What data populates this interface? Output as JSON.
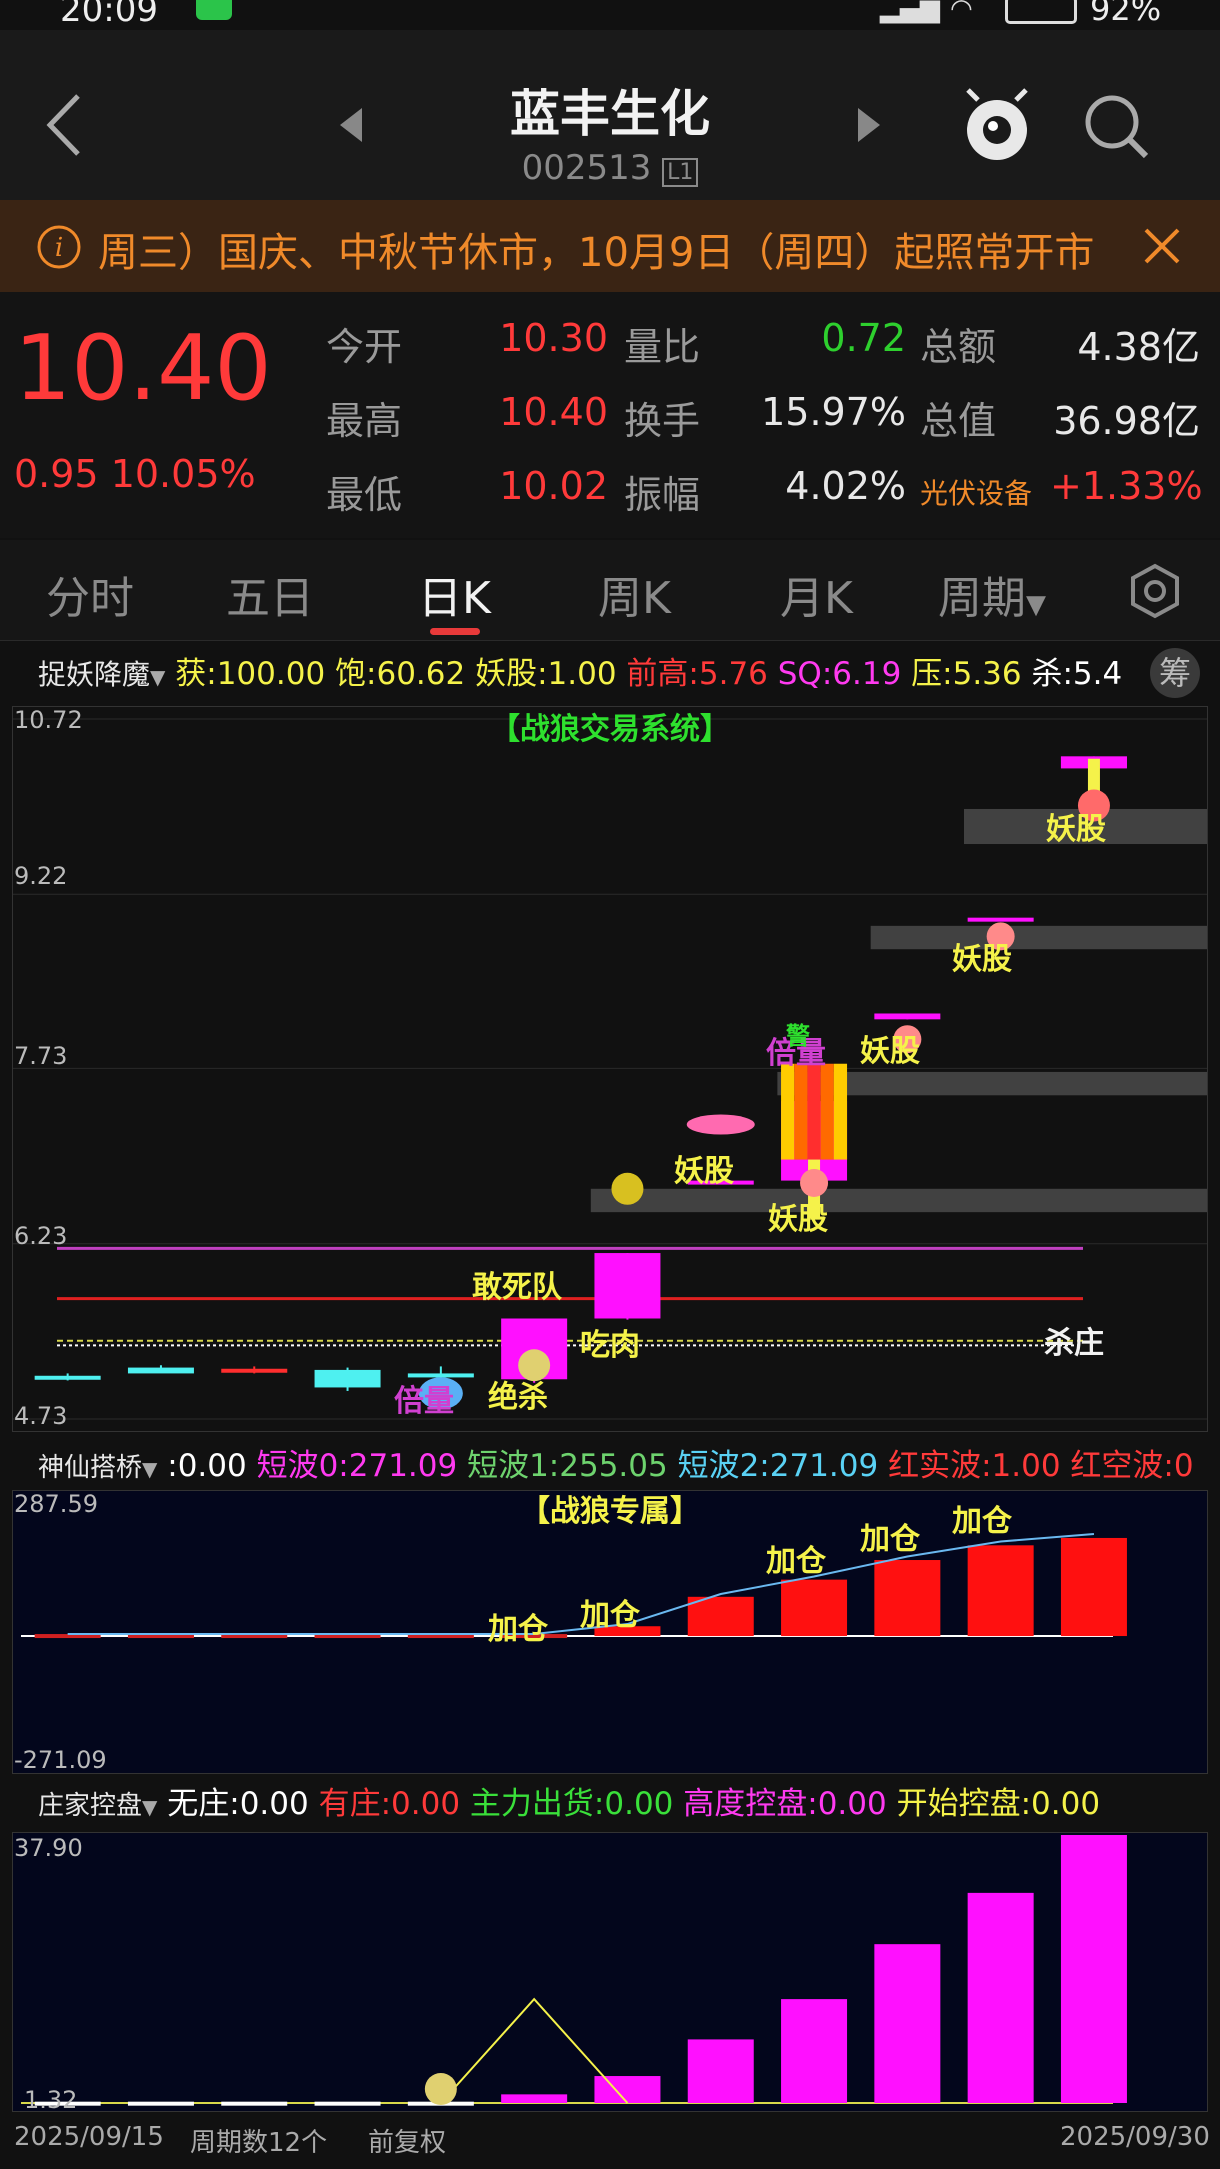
{
  "status": {
    "time": "20:09",
    "battery": "92%"
  },
  "header": {
    "title": "蓝丰生化",
    "code": "002513",
    "level_badge": "L1"
  },
  "notice": {
    "text": "周三）国庆、中秋节休市，10月9日（周四）起照常开市"
  },
  "quote": {
    "price": "10.40",
    "change": "0.95",
    "change_pct": "10.05%",
    "fields": {
      "open_label": "今开",
      "open": "10.30",
      "vol_ratio_label": "量比",
      "vol_ratio": "0.72",
      "amount_label": "总额",
      "amount": "4.38亿",
      "high_label": "最高",
      "high": "10.40",
      "turnover_label": "换手",
      "turnover": "15.97%",
      "mktcap_label": "总值",
      "mktcap": "36.98亿",
      "low_label": "最低",
      "low": "10.02",
      "amplitude_label": "振幅",
      "amplitude": "4.02%",
      "sector_label": "光伏设备",
      "sector_change": "+1.33%"
    }
  },
  "tabs": [
    {
      "label": "分时"
    },
    {
      "label": "五日"
    },
    {
      "label": "日K"
    },
    {
      "label": "周K"
    },
    {
      "label": "月K"
    },
    {
      "label": "周期"
    }
  ],
  "indicator1": {
    "name": "捉妖降魔",
    "items": [
      {
        "text": "获:100.00",
        "color": "#f5f24a"
      },
      {
        "text": "饱:60.62",
        "color": "#f5f24a"
      },
      {
        "text": "妖股:1.00",
        "color": "#f5f24a"
      },
      {
        "text": "前高:5.76",
        "color": "#ff3a3a"
      },
      {
        "text": "SQ:6.19",
        "color": "#ff3af0"
      },
      {
        "text": "压:5.36",
        "color": "#f5f24a"
      },
      {
        "text": "杀:5.4",
        "color": "#ffffff"
      }
    ],
    "chip_button": "筹"
  },
  "indicator2": {
    "name": "神仙搭桥",
    "items": [
      {
        "text": ":0.00",
        "color": "#ffffff"
      },
      {
        "text": "短波0:271.09",
        "color": "#ff3af0"
      },
      {
        "text": "短波1:255.05",
        "color": "#6ed36e"
      },
      {
        "text": "短波2:271.09",
        "color": "#5ad2f5"
      },
      {
        "text": "红实波:1.00",
        "color": "#ff3a3a"
      },
      {
        "text": "红空波:0",
        "color": "#ff3a3a"
      }
    ]
  },
  "indicator3": {
    "name": "庄家控盘",
    "items": [
      {
        "text": "无庄:0.00",
        "color": "#ffffff"
      },
      {
        "text": "有庄:0.00",
        "color": "#ff3a3a"
      },
      {
        "text": "主力出货:0.00",
        "color": "#3ae03a"
      },
      {
        "text": "高度控盘:0.00",
        "color": "#ff3af0"
      },
      {
        "text": "开始控盘:0.00",
        "color": "#f5f24a"
      }
    ]
  },
  "main_chart": {
    "title": "【战狼交易系统】",
    "y_ticks": [
      "10.72",
      "9.22",
      "7.73",
      "6.23",
      "4.73"
    ],
    "labels": {
      "gansidui": "敢死队",
      "chirou": "吃肉",
      "juesha": "绝杀",
      "beiliang1": "倍量",
      "beiliang2": "倍量",
      "shazhuang": "杀庄",
      "jing": "警",
      "yao1": "妖股",
      "yao2": "妖股",
      "yao3": "妖股",
      "yao4": "妖股",
      "yao5": "妖股"
    }
  },
  "mid_chart": {
    "title": "【战狼专属】",
    "y_max": "287.59",
    "y_min": "-271.09",
    "label": "加仓"
  },
  "bottom_chart": {
    "y_max": "37.90",
    "y_min": "1.32"
  },
  "chart_data": [
    {
      "type": "candlestick",
      "title": "【战狼交易系统】",
      "ylim": [
        4.73,
        10.72
      ],
      "y_ticks": [
        10.72,
        9.22,
        7.73,
        6.23,
        4.73
      ],
      "x_start": "2025/09/15",
      "x_end": "2025/09/30",
      "ohlc": [
        [
          5.1,
          5.12,
          5.06,
          5.09
        ],
        [
          5.17,
          5.19,
          5.13,
          5.12
        ],
        [
          5.16,
          5.18,
          5.12,
          5.16
        ],
        [
          5.15,
          5.17,
          4.97,
          5.0
        ],
        [
          5.12,
          5.18,
          5.06,
          5.09
        ],
        [
          5.07,
          5.59,
          5.04,
          5.59
        ],
        [
          5.59,
          6.15,
          5.58,
          6.15
        ],
        [
          6.77,
          6.77,
          6.77,
          6.77
        ],
        [
          7.45,
          7.77,
          6.42,
          6.77
        ],
        [
          8.15,
          8.2,
          8.15,
          8.2
        ],
        [
          9.02,
          9.02,
          9.02,
          9.02
        ],
        [
          10.3,
          10.4,
          10.02,
          10.4
        ]
      ]
    },
    {
      "type": "bar",
      "title": "【战狼专属】",
      "ylim": [
        -271.09,
        287.59
      ],
      "values": [
        0,
        0,
        0,
        0,
        0,
        0,
        20,
        80,
        115,
        155,
        185,
        200
      ]
    },
    {
      "type": "bar",
      "ylim": [
        1.32,
        37.9
      ],
      "values": [
        1.5,
        1.5,
        1.5,
        1.5,
        1.5,
        2.5,
        5.0,
        10.0,
        15.5,
        23.0,
        30.0,
        37.9
      ]
    }
  ],
  "footer": {
    "start_date": "2025/09/15",
    "period_count": "周期数12个",
    "adjust": "前复权",
    "end_date": "2025/09/30"
  }
}
